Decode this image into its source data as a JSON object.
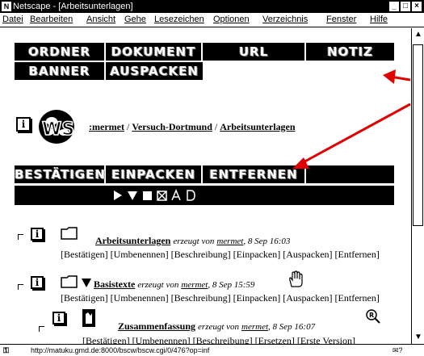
{
  "window": {
    "title": "Netscape - [Arbeitsunterlagen]",
    "app_icon": "netscape-icon"
  },
  "menu": [
    "Datei",
    "Bearbeiten",
    "Ansicht",
    "Gehe",
    "Lesezeichen",
    "Optionen",
    "Verzeichnis",
    "Fenster",
    "Hilfe"
  ],
  "toolbar": {
    "row1": [
      "ORDNER",
      "DOKUMENT",
      "URL",
      "NOTIZ"
    ],
    "row2": [
      "BANNER",
      "AUSPACKEN"
    ]
  },
  "breadcrumb": {
    "logo": "WS",
    "parts": [
      ":mermet",
      "Versuch-Dortmund",
      "Arbeitsunterlagen"
    ],
    "sep": " / "
  },
  "actions": [
    "BESTÄTIGEN",
    "EINPACKEN",
    "ENTFERNEN"
  ],
  "selection_icons": [
    "play-icon",
    "select-down-icon",
    "square-icon",
    "cross-box-icon",
    "letter-a-icon",
    "letter-d-icon"
  ],
  "items": [
    {
      "name": "Arbeitsunterlagen",
      "meta_prefix": "erzeugt von",
      "user": "mermet",
      "date": "8 Sep 16:03",
      "actions": "[Bestätigen] [Umbenennen] [Beschreibung] [Einpacken] [Auspacken] [Entfernen]"
    },
    {
      "name": "Basistexte",
      "meta_prefix": "erzeugt von",
      "user": "mermet",
      "date": "8 Sep 15:59",
      "actions": "[Bestätigen] [Umbenennen] [Beschreibung] [Einpacken] [Auspacken] [Entfernen]"
    },
    {
      "name": "Zusammenfassung",
      "meta_prefix": "erzeugt von",
      "user": "mermet",
      "date": "8 Sep 16:07",
      "actions": "[Bestätigen] [Umbenennen] [Beschreibung] [Ersetzen] [Erste Version]"
    }
  ],
  "status": {
    "url": "http://matuku.gmd.de:8000/bscw/bscw.cgi/0/476?op=inf"
  },
  "colors": {
    "accent_arrow": "#e00000"
  }
}
